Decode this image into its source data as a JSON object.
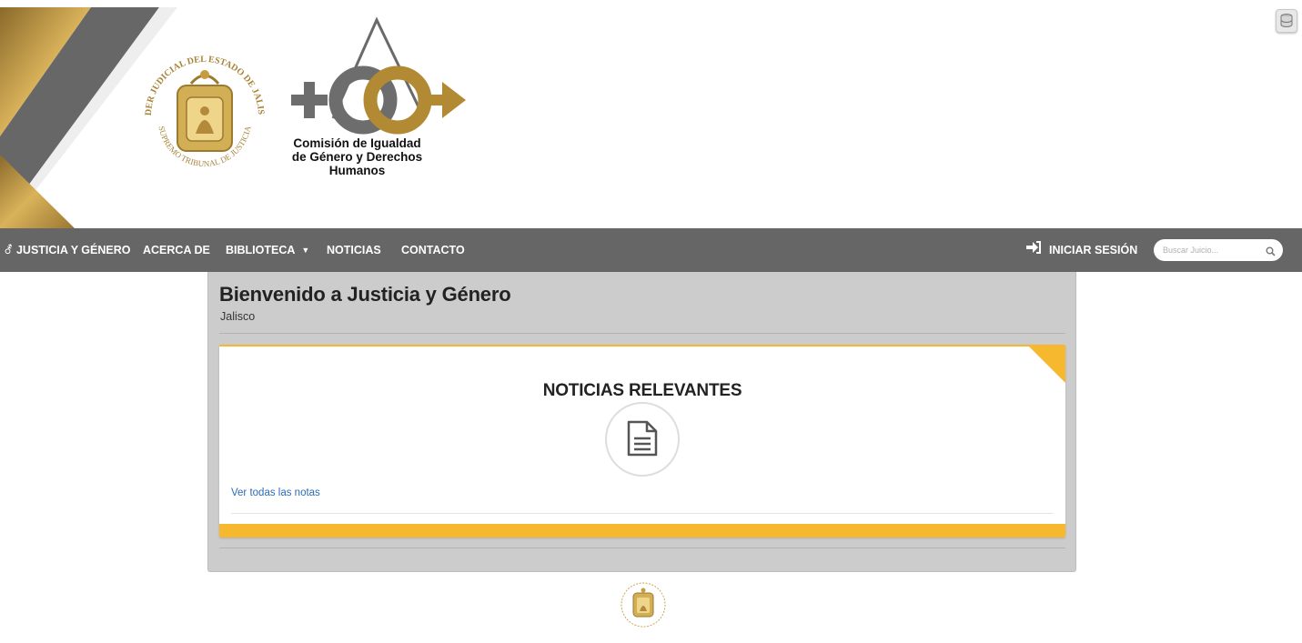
{
  "header": {
    "seal_text_top": "PODER JUDICIAL DEL ESTADO DE JALISCO",
    "seal_text_bottom": "SUPREMO TRIBUNAL DE JUSTICIA",
    "commission_line1": "Comisión de Igualdad",
    "commission_line2": "de Género y Derechos",
    "commission_line3": "Humanos"
  },
  "nav": {
    "brand": "JUSTICIA Y GÉNERO",
    "brand_icon": "gender-icon",
    "items": [
      {
        "label": "ACERCA DE"
      },
      {
        "label": "BIBLIOTECA"
      },
      {
        "label": "NOTICIAS"
      },
      {
        "label": "CONTACTO"
      }
    ],
    "login_label": "INICIAR SESIÓN",
    "login_icon": "sign-in-icon",
    "search_placeholder": "Buscar Juicio..."
  },
  "main": {
    "title": "Bienvenido a Justicia y Género",
    "subtitle": "Jalisco",
    "news": {
      "title": "NOTICIAS RELEVANTES",
      "icon": "document-icon",
      "link": "Ver todas las notas"
    }
  },
  "colors": {
    "gold": "#b08a3e",
    "navbar": "#666666",
    "accent_yellow": "#f5b82e",
    "panel": "#cccccc",
    "link": "#2a6cb6"
  }
}
